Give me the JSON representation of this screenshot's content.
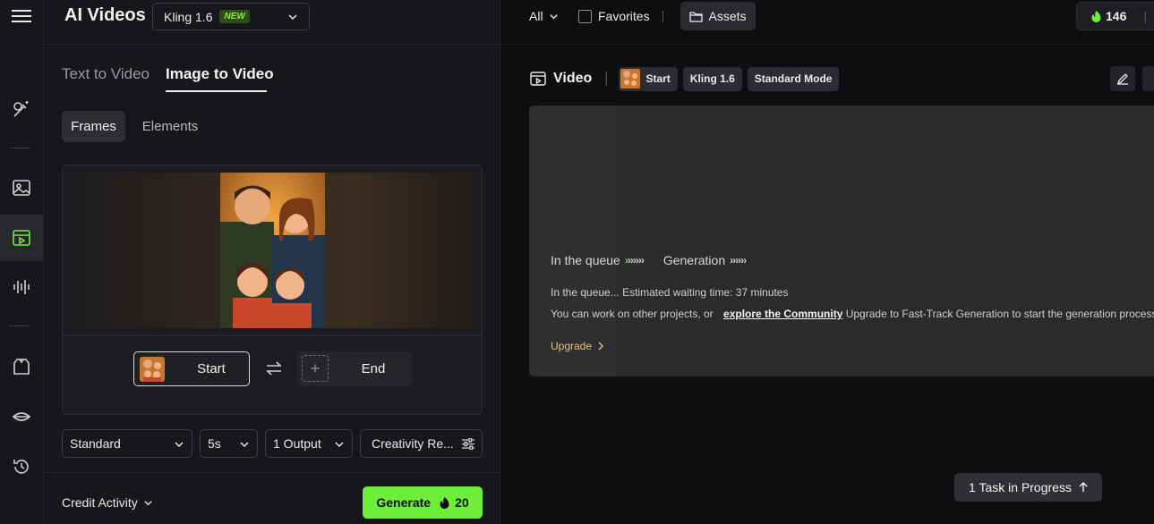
{
  "header": {
    "title": "AI Videos",
    "model": "Kling 1.6",
    "model_badge": "NEW"
  },
  "tabs": [
    {
      "label": "Text to Video"
    },
    {
      "label": "Image to Video"
    }
  ],
  "subtabs": [
    {
      "label": "Frames"
    },
    {
      "label": "Elements"
    }
  ],
  "frames": {
    "start_label": "Start",
    "end_label": "End"
  },
  "controls": {
    "mode": "Standard",
    "duration": "5s",
    "outputs": "1 Output",
    "creativity": "Creativity Re..."
  },
  "footer": {
    "credit_activity": "Credit Activity",
    "generate_label": "Generate",
    "generate_cost": "20"
  },
  "right_header": {
    "filter": "All",
    "favorites": "Favorites",
    "assets": "Assets",
    "credits": "146"
  },
  "video": {
    "title": "Video",
    "tags": [
      "Start",
      "Kling 1.6",
      "Standard Mode"
    ]
  },
  "queue": {
    "stage1": "In the queue",
    "stage2": "Generation",
    "chevrons1": "››››››",
    "chevrons2": "››››››",
    "wait_text": "In the queue... Estimated waiting time: 37 minutes",
    "work_text": "You can work on other projects, or",
    "community_link": "explore the Community",
    "upgrade_text": "Upgrade to Fast-Track Generation to start the generation process",
    "upgrade_label": "Upgrade"
  },
  "tasks": {
    "label": "1 Task in Progress"
  },
  "colors": {
    "accent": "#6dee3a",
    "upgrade": "#e7c27a"
  }
}
